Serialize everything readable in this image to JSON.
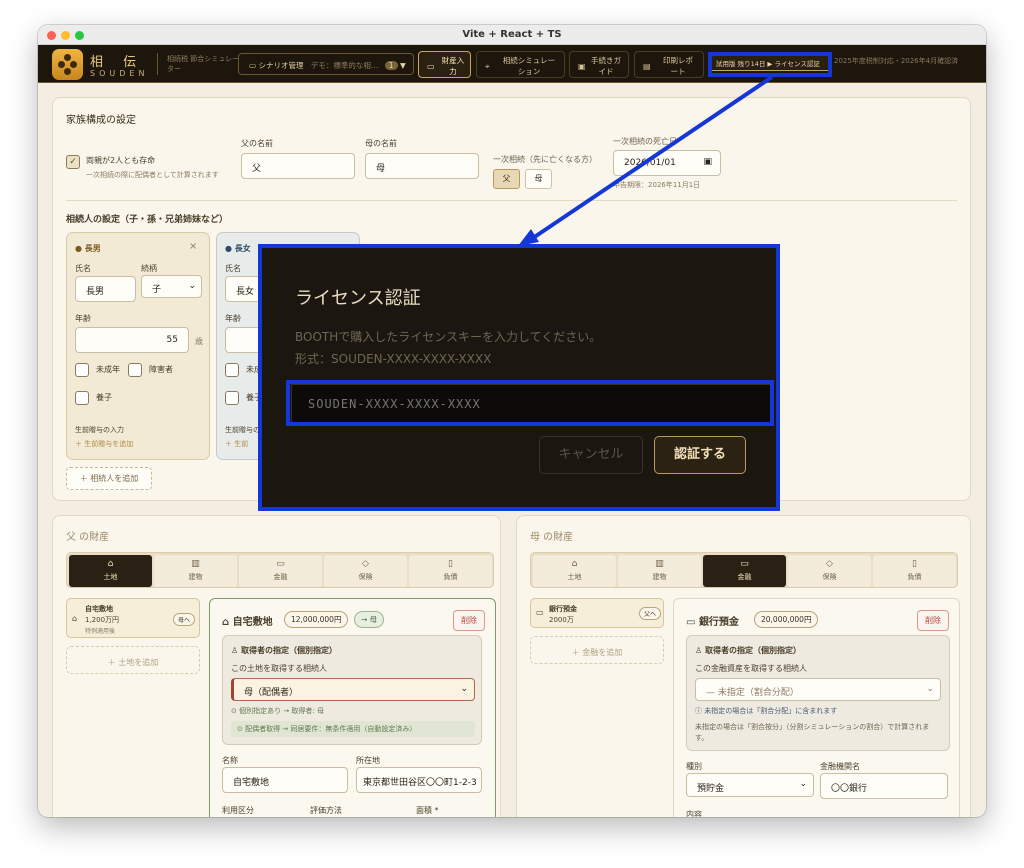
{
  "window": {
    "title": "Vite + React + TS"
  },
  "header": {
    "brand_jp": "相 伝",
    "brand_en": "SOUDEN",
    "app_tag": "相続税 節合シミュレーター",
    "scenario_label": "シナリオ管理",
    "scenario_demo": "デモ：標準的な相…",
    "scenario_count": "1",
    "nav": {
      "asset": "財産入力",
      "simulation": "相続シミュレーション",
      "guide": "手続きガイド",
      "print": "印刷レポート"
    },
    "trial": "試用版 残り14日 ▶ ライセンス認証",
    "tax_note": "2025年度税制対応・2026年4月確認済"
  },
  "family": {
    "title": "家族構成の設定",
    "both_alive_label": "両親が2人とも存命",
    "both_alive_sub": "一次相続の際に配偶者として計算されます",
    "father_label": "父の名前",
    "father_value": "父",
    "mother_label": "母の名前",
    "mother_value": "母",
    "first_label": "一次相続（先に亡くなる方）",
    "first_father": "父",
    "first_mother": "母",
    "death_label": "一次相続の死亡日",
    "death_value": "2026/01/01",
    "deadline": "申告期限：2026年11月1日",
    "heirs_title": "相続人の設定（子・孫・兄弟姉妹など）",
    "heir1": {
      "title": "長男",
      "name_label": "氏名",
      "rel_label": "続柄",
      "name": "長男",
      "rel": "子",
      "age_label": "年齢",
      "age": "55",
      "unit": "歳",
      "minor": "未成年",
      "disabled": "障害者",
      "adopted": "養子",
      "gift_label": "生前贈与の入力",
      "gift_add": "＋ 生前贈与を追加"
    },
    "heir2": {
      "title": "長女",
      "name_label": "氏名",
      "name": "長女",
      "age_label": "年齢",
      "minor": "未成",
      "adopted": "養子",
      "gift_label": "生前贈与の入力",
      "gift_add": "＋ 生前"
    },
    "add_heir": "＋ 相続人を追加"
  },
  "father_assets": {
    "title": "父 の財産",
    "tabs": [
      "土地",
      "建物",
      "金融",
      "保険",
      "負債"
    ],
    "item": {
      "name": "自宅敷地",
      "amount": "1,200万円",
      "note": "特例適用後",
      "badge": "母へ"
    },
    "add": "＋ 土地を追加",
    "detail": {
      "title": "自宅敷地",
      "amount": "12,000,000円",
      "to": "→ 母",
      "delete": "削除",
      "acq_title": "取得者の指定（個別指定）",
      "acq_sub": "この土地を取得する相続人",
      "acq_value": "母（配偶者）",
      "acq_note": "個別指定あり → 取得者: 母",
      "acq_note2": "配偶者取得 → 同居要件：無条件適用（自動設定済み）",
      "name_label": "名称",
      "name_value": "自宅敷地",
      "loc_label": "所在地",
      "loc_value": "東京都世田谷区〇〇町1-2-3",
      "use_label": "利用区分",
      "eval_label": "評価方法",
      "area_label": "面積 *"
    }
  },
  "mother_assets": {
    "title": "母 の財産",
    "tabs": [
      "土地",
      "建物",
      "金融",
      "保険",
      "負債"
    ],
    "item": {
      "name": "銀行預金",
      "amount": "2000万",
      "badge": "父へ"
    },
    "add": "＋ 金融を追加",
    "detail": {
      "title": "銀行預金",
      "amount": "20,000,000円",
      "delete": "削除",
      "acq_title": "取得者の指定（個別指定）",
      "acq_sub": "この金融資産を取得する相続人",
      "acq_value": "— 未指定（割合分配）",
      "note1": "未指定の場合は「割合分配」に含まれます",
      "note2": "未指定の場合は「割合按分」（分割シミュレーションの割合）で計算されます。",
      "type_label": "種別",
      "type_value": "預貯金",
      "bank_label": "金融機関名",
      "bank_value": "〇〇銀行",
      "content_label": "内容"
    }
  },
  "modal": {
    "title": "ライセンス認証",
    "desc1": "BOOTHで購入したライセンスキーを入力してください。",
    "desc2": "形式：SOUDEN-XXXX-XXXX-XXXX",
    "placeholder": "SOUDEN-XXXX-XXXX-XXXX",
    "cancel": "キャンセル",
    "confirm": "認証する"
  },
  "colors": {
    "accent": "#c9a55a",
    "highlight": "#1437d6",
    "header_bg": "#1c160c"
  }
}
